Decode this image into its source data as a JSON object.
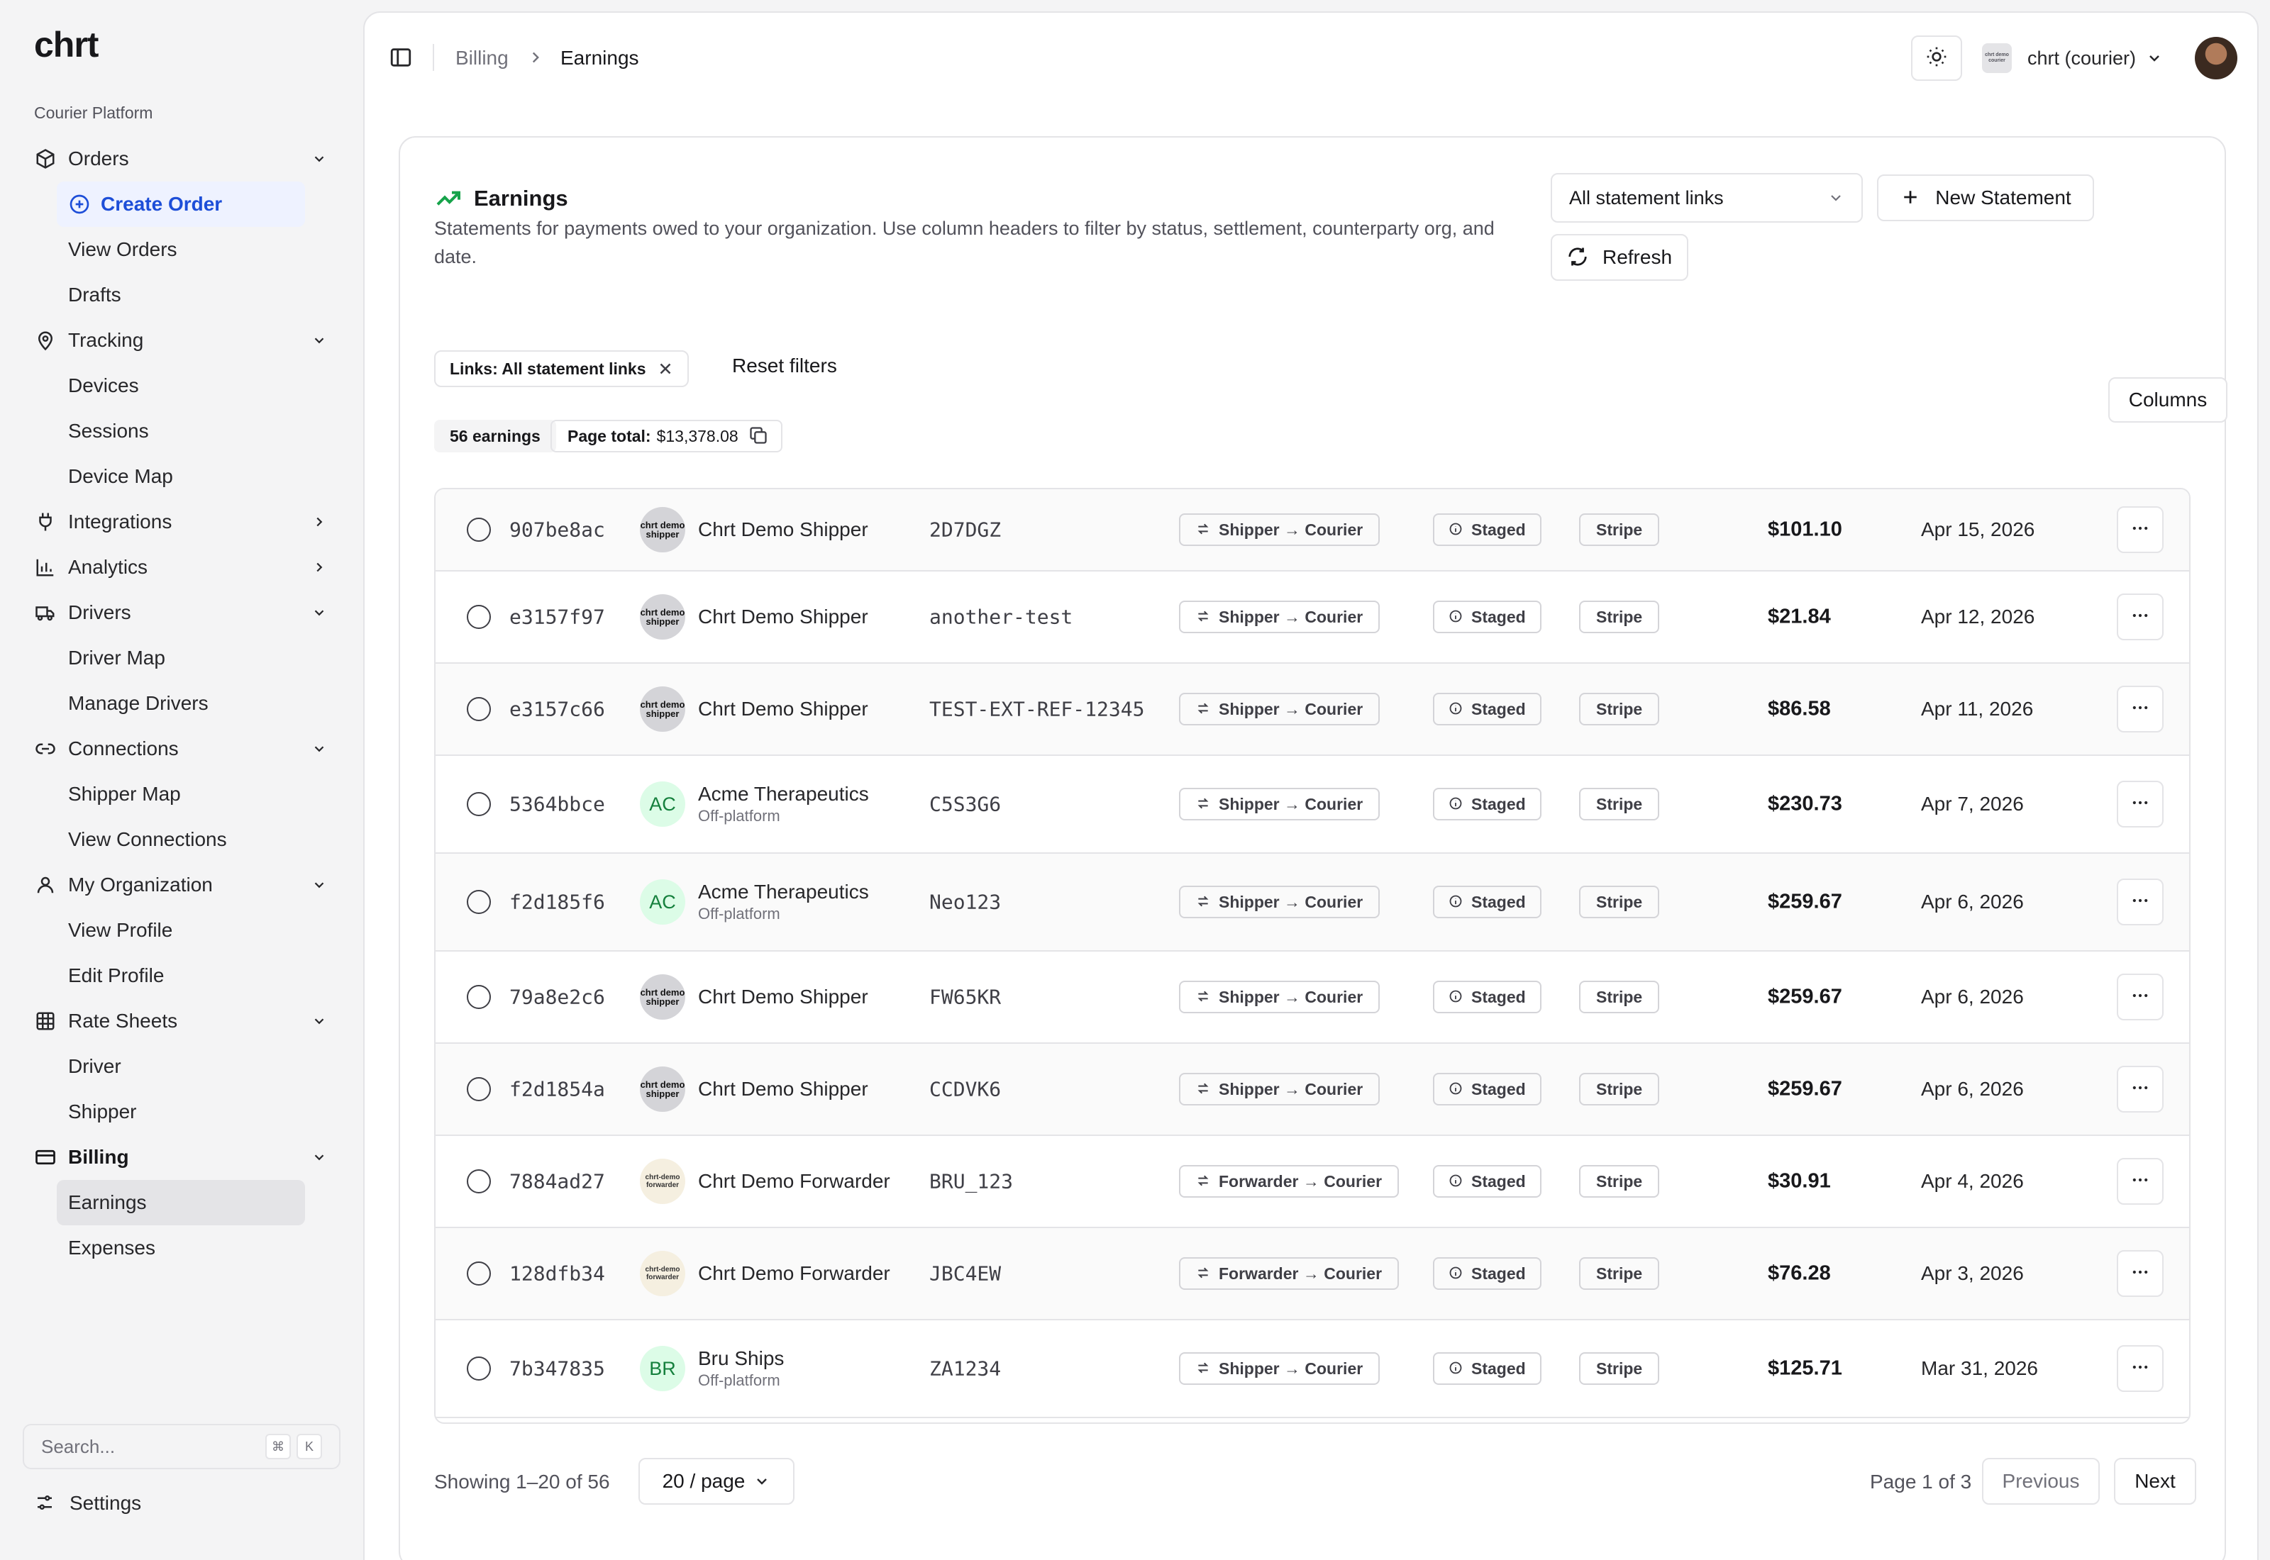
{
  "app": {
    "logo": "chrt",
    "section": "Courier Platform"
  },
  "sidebar": {
    "orders": {
      "label": "Orders",
      "items": [
        "Create Order",
        "View Orders",
        "Drafts"
      ]
    },
    "tracking": {
      "label": "Tracking",
      "items": [
        "Devices",
        "Sessions",
        "Device Map"
      ]
    },
    "integrations": {
      "label": "Integrations"
    },
    "analytics": {
      "label": "Analytics"
    },
    "drivers": {
      "label": "Drivers",
      "items": [
        "Driver Map",
        "Manage Drivers"
      ]
    },
    "connections": {
      "label": "Connections",
      "items": [
        "Shipper Map",
        "View Connections"
      ]
    },
    "my_org": {
      "label": "My Organization",
      "items": [
        "View Profile",
        "Edit Profile"
      ]
    },
    "rate_sheets": {
      "label": "Rate Sheets",
      "items": [
        "Driver",
        "Shipper"
      ]
    },
    "billing": {
      "label": "Billing",
      "items": [
        "Earnings",
        "Expenses"
      ],
      "active": "Earnings"
    },
    "search_placeholder": "Search...",
    "search_keys": [
      "⌘",
      "K"
    ],
    "settings": "Settings"
  },
  "topbar": {
    "breadcrumb": [
      "Billing",
      "Earnings"
    ],
    "org_name": "chrt (courier)",
    "org_logo_text": "chrt demo courier"
  },
  "page": {
    "title": "Earnings",
    "description": "Statements for payments owed to your organization. Use column headers to filter by status, settlement, counterparty org, and date.",
    "links_select": "All statement links",
    "new_statement": "New Statement",
    "refresh": "Refresh",
    "filter_chip": "Links: All statement links",
    "reset_filters": "Reset filters",
    "columns": "Columns",
    "count_badge": "56 earnings",
    "page_total_label": "Page total:",
    "page_total_value": "$13,378.08"
  },
  "rows": [
    {
      "id": "907be8ac",
      "org": "Chrt Demo Shipper",
      "org_sub": "",
      "logo": "shipper",
      "logo_text": "chrt demo shipper",
      "ref": "2D7DGZ",
      "direction": "Shipper → Courier",
      "status": "Staged",
      "settlement": "Stripe",
      "amount": "$101.10",
      "date": "Apr 15, 2026"
    },
    {
      "id": "e3157f97",
      "org": "Chrt Demo Shipper",
      "org_sub": "",
      "logo": "shipper",
      "logo_text": "chrt demo shipper",
      "ref": "another-test",
      "direction": "Shipper → Courier",
      "status": "Staged",
      "settlement": "Stripe",
      "amount": "$21.84",
      "date": "Apr 12, 2026"
    },
    {
      "id": "e3157c66",
      "org": "Chrt Demo Shipper",
      "org_sub": "",
      "logo": "shipper",
      "logo_text": "chrt demo shipper",
      "ref": "TEST-EXT-REF-12345",
      "direction": "Shipper → Courier",
      "status": "Staged",
      "settlement": "Stripe",
      "amount": "$86.58",
      "date": "Apr 11, 2026"
    },
    {
      "id": "5364bbce",
      "org": "Acme Therapeutics",
      "org_sub": "Off-platform",
      "logo": "initials",
      "logo_text": "AC",
      "ref": "C5S3G6",
      "direction": "Shipper → Courier",
      "status": "Staged",
      "settlement": "Stripe",
      "amount": "$230.73",
      "date": "Apr 7, 2026"
    },
    {
      "id": "f2d185f6",
      "org": "Acme Therapeutics",
      "org_sub": "Off-platform",
      "logo": "initials",
      "logo_text": "AC",
      "ref": "Neo123",
      "direction": "Shipper → Courier",
      "status": "Staged",
      "settlement": "Stripe",
      "amount": "$259.67",
      "date": "Apr 6, 2026"
    },
    {
      "id": "79a8e2c6",
      "org": "Chrt Demo Shipper",
      "org_sub": "",
      "logo": "shipper",
      "logo_text": "chrt demo shipper",
      "ref": "FW65KR",
      "direction": "Shipper → Courier",
      "status": "Staged",
      "settlement": "Stripe",
      "amount": "$259.67",
      "date": "Apr 6, 2026"
    },
    {
      "id": "f2d1854a",
      "org": "Chrt Demo Shipper",
      "org_sub": "",
      "logo": "shipper",
      "logo_text": "chrt demo shipper",
      "ref": "CCDVK6",
      "direction": "Shipper → Courier",
      "status": "Staged",
      "settlement": "Stripe",
      "amount": "$259.67",
      "date": "Apr 6, 2026"
    },
    {
      "id": "7884ad27",
      "org": "Chrt Demo Forwarder",
      "org_sub": "",
      "logo": "forwarder",
      "logo_text": "chrt-demo forwarder",
      "ref": "BRU_123",
      "direction": "Forwarder → Courier",
      "status": "Staged",
      "settlement": "Stripe",
      "amount": "$30.91",
      "date": "Apr 4, 2026"
    },
    {
      "id": "128dfb34",
      "org": "Chrt Demo Forwarder",
      "org_sub": "",
      "logo": "forwarder",
      "logo_text": "chrt-demo forwarder",
      "ref": "JBC4EW",
      "direction": "Forwarder → Courier",
      "status": "Staged",
      "settlement": "Stripe",
      "amount": "$76.28",
      "date": "Apr 3, 2026"
    },
    {
      "id": "7b347835",
      "org": "Bru Ships",
      "org_sub": "Off-platform",
      "logo": "initials",
      "logo_text": "BR",
      "ref": "ZA1234",
      "direction": "Shipper → Courier",
      "status": "Staged",
      "settlement": "Stripe",
      "amount": "$125.71",
      "date": "Mar 31, 2026"
    }
  ],
  "footer": {
    "showing": "Showing 1–20 of 56",
    "per_page": "20 / page",
    "page_of": "Page 1 of 3",
    "previous": "Previous",
    "next": "Next"
  },
  "colors": {
    "accent": "#1d4ed8",
    "success": "#16a34a",
    "border": "#e4e4e7"
  }
}
